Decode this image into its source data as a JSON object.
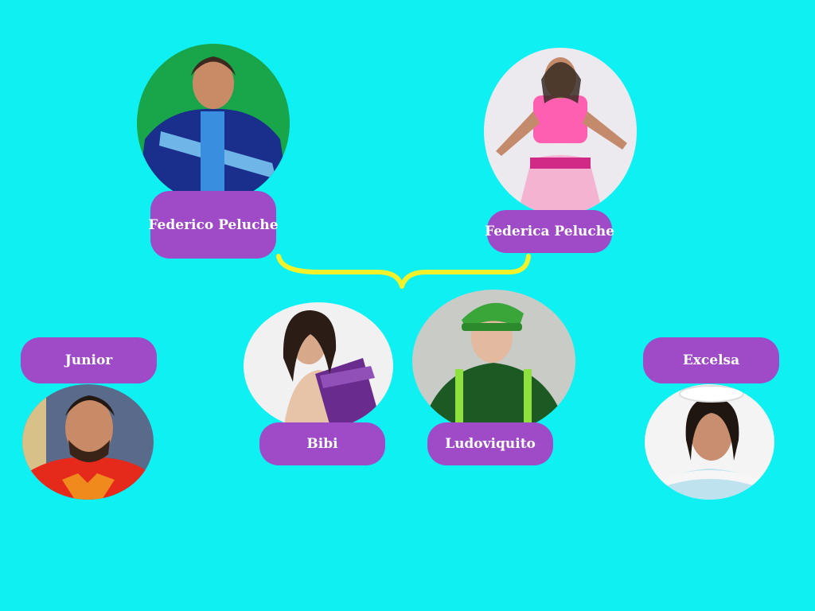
{
  "colors": {
    "background": "#0ff0f3",
    "label_fill": "#9f4bc7",
    "label_text": "#ffffff",
    "connector": "#f2f22a"
  },
  "parents": [
    {
      "name": "Federico Peluche"
    },
    {
      "name": "Federica Peluche"
    }
  ],
  "children": [
    {
      "name": "Bibi"
    },
    {
      "name": "Ludoviquito"
    }
  ],
  "relatives": [
    {
      "name": "Junior"
    },
    {
      "name": "Excelsa"
    }
  ]
}
